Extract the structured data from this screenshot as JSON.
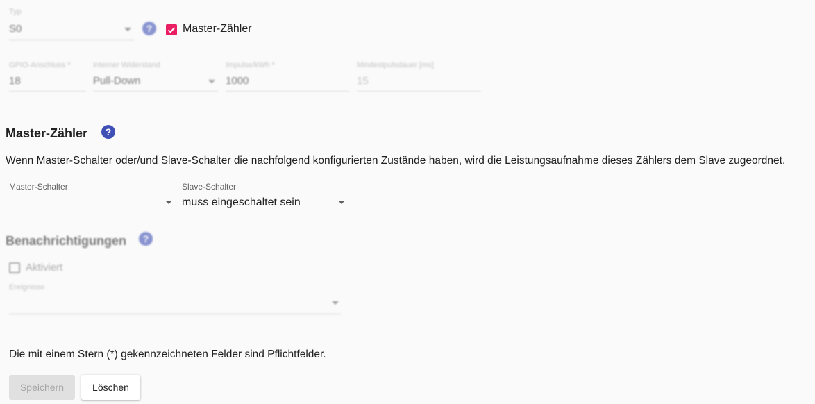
{
  "meter": {
    "type": {
      "label": "Typ",
      "value": "S0"
    },
    "master_checkbox_label": "Master-Zähler",
    "gpio": {
      "label": "GPIO-Anschluss *",
      "value": "18"
    },
    "resistor": {
      "label": "Interner Widerstand",
      "value": "Pull-Down"
    },
    "impulses": {
      "label": "Impulse/kWh *",
      "value": "1000"
    },
    "min_pulse": {
      "label": "Mindestpulsdauer [ms]",
      "placeholder": "15"
    }
  },
  "master_section": {
    "title": "Master-Zähler",
    "description": "Wenn Master-Schalter oder/und Slave-Schalter die nachfolgend konfigurierten Zustände haben, wird die Leistungsaufnahme dieses Zählers dem Slave zugeordnet.",
    "master_switch": {
      "label": "Master-Schalter",
      "value": ""
    },
    "slave_switch": {
      "label": "Slave-Schalter",
      "value": "muss eingeschaltet sein"
    }
  },
  "notifications": {
    "title": "Benachrichtigungen",
    "enabled_label": "Aktiviert",
    "events_label": "Ereignisse"
  },
  "footer": {
    "required_note": "Die mit einem Stern (*) gekennzeichneten Felder sind Pflichtfelder.",
    "save_label": "Speichern",
    "delete_label": "Löschen"
  },
  "colors": {
    "accent": "#3f51b5",
    "checkbox": "#e91e63",
    "disabled_button": "#e0e0e0"
  }
}
